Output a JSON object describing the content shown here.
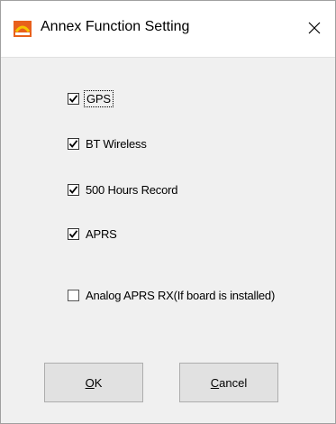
{
  "window": {
    "title": "Annex Function Setting",
    "icon": "app-logo-icon",
    "close_icon": "close-icon"
  },
  "options": [
    {
      "label": "GPS",
      "checked": true,
      "focused": true
    },
    {
      "label": "BT Wireless",
      "checked": true,
      "focused": false
    },
    {
      "label": "500 Hours Record",
      "checked": true,
      "focused": false
    },
    {
      "label": "APRS",
      "checked": true,
      "focused": false
    },
    {
      "label": "Analog APRS RX(If board is installed)",
      "checked": false,
      "focused": false
    }
  ],
  "buttons": {
    "ok": {
      "mnemonic": "O",
      "rest": "K"
    },
    "cancel": {
      "mnemonic": "C",
      "rest": "ancel"
    }
  },
  "colors": {
    "dialog_bg": "#f0f0f0",
    "titlebar_bg": "#ffffff",
    "icon_orange": "#e8601c",
    "icon_yellow": "#f5c400"
  }
}
